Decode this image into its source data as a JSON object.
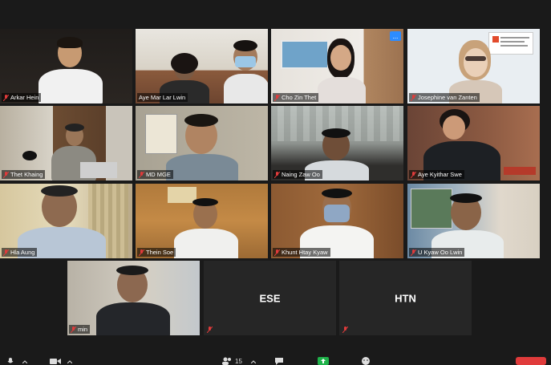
{
  "tiles": [
    {
      "name": "Arkar Hein",
      "muted": true
    },
    {
      "name": "Aye Mar Lar Lwin",
      "muted": false
    },
    {
      "name": "Cho Zin Thet",
      "muted": true
    },
    {
      "name": "Josephine van Zanten",
      "muted": true
    },
    {
      "name": "Thet Khaing",
      "muted": true
    },
    {
      "name": "MD MGE",
      "muted": true
    },
    {
      "name": "Naing Zaw Oo",
      "muted": true
    },
    {
      "name": "Aye Kyithar Swe",
      "muted": true
    },
    {
      "name": "Hla Aung",
      "muted": true
    },
    {
      "name": "Thein Soe",
      "muted": true
    },
    {
      "name": "Khunt Htay Kyaw",
      "muted": true
    },
    {
      "name": "U Kyaw Oo Lwin",
      "muted": true
    },
    {
      "name": "min",
      "muted": true
    },
    {
      "name": "",
      "initials": "ESE",
      "muted": true
    },
    {
      "name": "",
      "initials": "HTN",
      "muted": true
    }
  ],
  "toolbar": {
    "participants_count": "15",
    "more_label": "..."
  },
  "colors": {
    "active_outline": "#cfe36a",
    "accent": "#2d8cff",
    "mute_red": "#e03b3b"
  }
}
